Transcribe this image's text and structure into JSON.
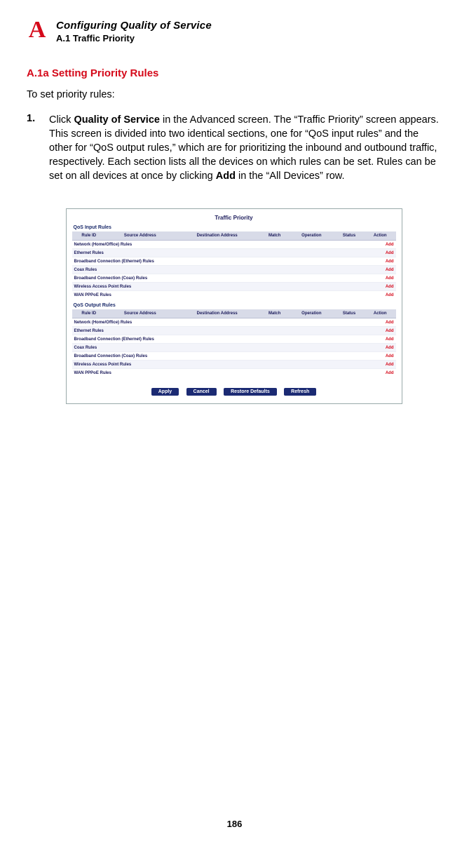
{
  "header": {
    "appendix_letter": "A",
    "chapter_title": "Configuring Quality of Service",
    "chapter_sub": "A.1  Traffic Priority"
  },
  "section": {
    "heading": "A.1a  Setting Priority Rules",
    "intro": "To set priority rules:"
  },
  "step1": {
    "num": "1.",
    "pre": "Click ",
    "b1": "Quality of Service",
    "mid": " in the Advanced screen. The “Traffic Priority” screen appears. This screen is divided into two identical sections, one for “QoS input rules” and the other for “QoS output rules,” which are for prioritizing the inbound and outbound traffic, respectively. Each section lists all the devices on which rules can be set. Rules can be set on all devices at once by clicking ",
    "b2": "Add",
    "post": " in the “All Devices” row."
  },
  "figure": {
    "title": "Traffic Priority",
    "input_label": "QoS Input Rules",
    "output_label": "QoS Output Rules",
    "cols": {
      "rule": "Rule ID",
      "src": "Source Address",
      "dst": "Destination Address",
      "match": "Match",
      "oper": "Operation",
      "status": "Status",
      "action": "Action"
    },
    "devices": [
      "Network (Home/Office) Rules",
      "Ethernet Rules",
      "Broadband Connection (Ethernet) Rules",
      "Coax Rules",
      "Broadband Connection (Coax) Rules",
      "Wireless Access Point Rules",
      "WAN PPPoE Rules"
    ],
    "add_label": "Add",
    "buttons": {
      "apply": "Apply",
      "cancel": "Cancel",
      "restore": "Restore Defaults",
      "refresh": "Refresh"
    }
  },
  "page_number": "186"
}
